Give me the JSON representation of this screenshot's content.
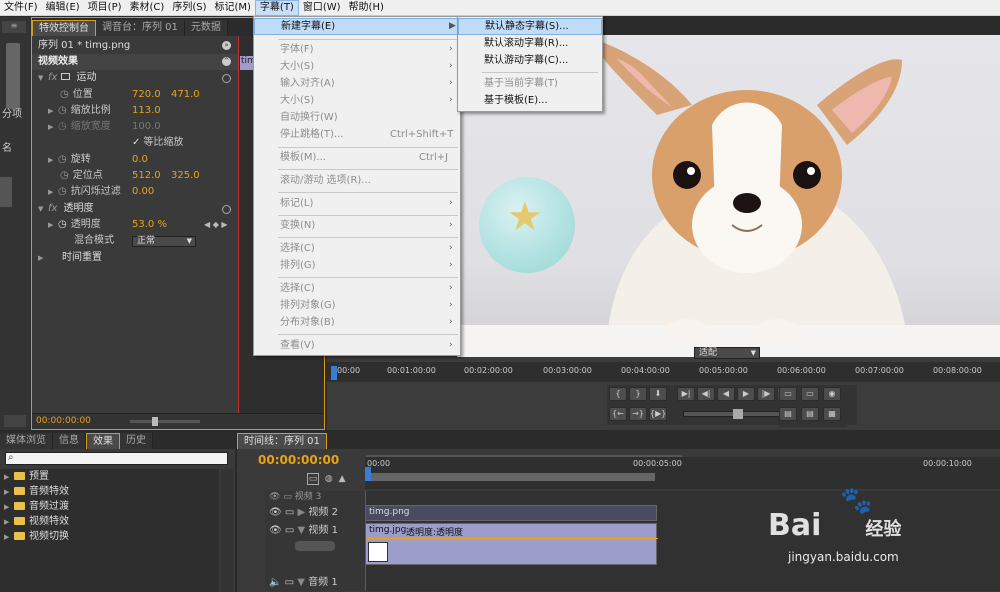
{
  "menubar": [
    "文件(F)",
    "编辑(E)",
    "项目(P)",
    "素材(C)",
    "序列(S)",
    "标记(M)",
    "字幕(T)",
    "窗口(W)",
    "帮助(H)"
  ],
  "effect_controls": {
    "tabs": [
      "特效控制台",
      "调音台：序列 01",
      "元数据"
    ],
    "source": "序列 01 * timg.png",
    "clip_tag": "tim",
    "video_effects": "视频效果",
    "motion": "运动",
    "position": {
      "label": "位置",
      "x": "720.0",
      "y": "471.0"
    },
    "scale": {
      "label": "缩放比例",
      "value": "113.0"
    },
    "scale_width": {
      "label": "缩放宽度",
      "value": "100.0"
    },
    "uniform": "等比缩放",
    "rotation": {
      "label": "旋转",
      "value": "0.0"
    },
    "anchor": {
      "label": "定位点",
      "x": "512.0",
      "y": "325.0"
    },
    "antiflicker": {
      "label": "抗闪烁过滤",
      "value": "0.00"
    },
    "opacity_group": "透明度",
    "opacity": {
      "label": "透明度",
      "value": "53.0 %"
    },
    "blend_mode": {
      "label": "混合模式",
      "value": "正常"
    },
    "time_remap": "时间重置",
    "timecode": "00:00:00:00"
  },
  "left_strip": {
    "a": "分项",
    "b": "名"
  },
  "title_menu": {
    "items": [
      "新建字幕(E)",
      "字体(F)",
      "大小(S)",
      "输入对齐(A)",
      "大小(S)",
      "自动换行(W)",
      "停止跳格(T)...",
      "模板(M)...",
      "滚动/游动 选项(R)...",
      "标记(L)",
      "变换(N)",
      "选择(C)",
      "排列(G)",
      "选择(C)",
      "排列对象(G)",
      "分布对象(B)",
      "查看(V)"
    ],
    "shortcut_tab": "Ctrl+Shift+T",
    "shortcut_template": "Ctrl+J"
  },
  "submenu": {
    "items": [
      "默认静态字幕(S)...",
      "默认滚动字幕(R)...",
      "默认游动字幕(C)...",
      "基于当前字幕(T)",
      "基于模板(E)..."
    ]
  },
  "program": {
    "zoom": "适配",
    "ruler": [
      "00:00",
      "00:01:00:00",
      "00:02:00:00",
      "00:03:00:00",
      "00:04:00:00",
      "00:05:00:00",
      "00:06:00:00",
      "00:07:00:00",
      "00:08:00:00"
    ],
    "transport": [
      "{",
      "}",
      "⬇",
      "▶|",
      "◀|",
      "◀",
      "▶",
      "|▶",
      "▶|"
    ]
  },
  "project": {
    "tabs": [
      "媒体浏览",
      "信息",
      "效果",
      "历史"
    ],
    "search_placeholder": "",
    "folders": [
      "预置",
      "音频特效",
      "音频过渡",
      "视频特效",
      "视频切换"
    ]
  },
  "timeline": {
    "tab": "时间线：序列 01",
    "timecode": "00:00:00:00",
    "ruler": [
      "00:00",
      "00:00:05:00",
      "00:00:10:00"
    ],
    "tracks": [
      "视频 3",
      "视频 2",
      "视频 1",
      "音频 1"
    ],
    "clip_v2": "timg.png",
    "clip_v1": "timg.jpg",
    "clip_v1_fx": "透明度:透明度"
  },
  "watermark": {
    "brand": "Bai",
    "brand2": "经验",
    "url": "jingyan.baidu.com"
  },
  "colors": {
    "accent": "#e8a317",
    "highlight": "#bfdcf8",
    "clip": "#9d9dcc"
  }
}
